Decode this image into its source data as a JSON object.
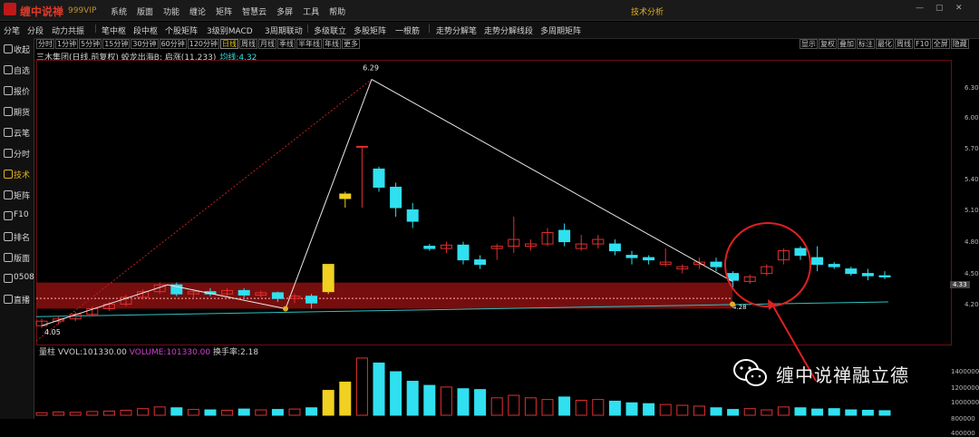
{
  "app": {
    "name": "缠中说禅",
    "version": "999VIP",
    "center_title": "技术分析"
  },
  "menu": [
    "系统",
    "版面",
    "功能",
    "缠论",
    "矩阵",
    "智慧云",
    "多屏",
    "工具",
    "帮助"
  ],
  "toolbar": [
    "分笔",
    "分段",
    "动力共振",
    "笔中枢",
    "段中枢",
    "个股矩阵",
    "3级别MACD",
    "3周期联动",
    "多级联立",
    "多股矩阵",
    "一根筋",
    "走势分解笔",
    "走势分解线段",
    "多周期矩阵"
  ],
  "sidebar": [
    {
      "label": "收起",
      "icon": "chevron-left-icon"
    },
    {
      "label": "自选",
      "icon": "star-icon"
    },
    {
      "label": "报价",
      "icon": "quote-icon"
    },
    {
      "label": "期货",
      "icon": "futures-icon"
    },
    {
      "label": "云笔",
      "icon": "cloud-icon"
    },
    {
      "label": "分时",
      "icon": "clock-icon"
    },
    {
      "label": "技术",
      "icon": "candlestick-icon",
      "active": true
    },
    {
      "label": "矩阵",
      "icon": "matrix-icon"
    },
    {
      "label": "F10",
      "icon": "f10-icon"
    },
    {
      "label": "排名",
      "icon": "ranking-icon"
    },
    {
      "label": "版面",
      "icon": "layout-icon"
    },
    {
      "label": "0508",
      "icon": "code-icon"
    },
    {
      "label": "直播",
      "icon": "live-icon"
    }
  ],
  "periods": [
    "分时",
    "1分钟",
    "5分钟",
    "15分钟",
    "30分钟",
    "60分钟",
    "120分钟",
    "日线",
    "周线",
    "月线",
    "季线",
    "半年线",
    "年线",
    "更多"
  ],
  "active_period": "日线",
  "right_buttons": [
    "显示",
    "复权",
    "叠加",
    "标注",
    "最化",
    "周线",
    "F10",
    "全屏",
    "隐藏"
  ],
  "info": {
    "text": "三木集团(日线,前复权) 蛟龙出海B: 启涨(11,233)",
    "ma": "均线:4.32"
  },
  "price_axis": [
    "6.30",
    "6.00",
    "5.70",
    "5.40",
    "5.10",
    "4.80",
    "4.50",
    "4.20"
  ],
  "current_price": "4.33",
  "volume_axis": [
    "1400000",
    "1200000",
    "1000000",
    "800000",
    "400000"
  ],
  "volume_header": {
    "label": "量柱",
    "vvol": "VVOL:101330.00",
    "volume": "VOLUME:101330.00",
    "turnover": "换手率:2.18"
  },
  "annotations": {
    "high": "6.29",
    "low": "4.05",
    "mark1": "4.28"
  },
  "watermark": "缠中说禅融立德",
  "colors": {
    "up": "#e03030",
    "down": "#30e0f0",
    "zone": "#8b1010",
    "accent": "#e0b020"
  },
  "chart_data": {
    "type": "candlestick",
    "ylim": [
      4.05,
      6.35
    ],
    "candles": [
      [
        4.12,
        4.16,
        4.1,
        4.18
      ],
      [
        4.16,
        4.18,
        4.13,
        4.2
      ],
      [
        4.18,
        4.22,
        4.16,
        4.24
      ],
      [
        4.22,
        4.27,
        4.2,
        4.29
      ],
      [
        4.27,
        4.31,
        4.25,
        4.33
      ],
      [
        4.31,
        4.37,
        4.29,
        4.39
      ],
      [
        4.37,
        4.42,
        4.35,
        4.44
      ],
      [
        4.42,
        4.48,
        4.4,
        4.5
      ],
      [
        4.48,
        4.4,
        4.38,
        4.5
      ],
      [
        4.4,
        4.42,
        4.37,
        4.44
      ],
      [
        4.42,
        4.4,
        4.38,
        4.45
      ],
      [
        4.4,
        4.43,
        4.38,
        4.45
      ],
      [
        4.43,
        4.39,
        4.37,
        4.45
      ],
      [
        4.39,
        4.41,
        4.37,
        4.43
      ],
      [
        4.41,
        4.36,
        4.33,
        4.42
      ],
      [
        4.36,
        4.38,
        4.32,
        4.4
      ],
      [
        4.38,
        4.32,
        4.27,
        4.4
      ],
      [
        4.66,
        4.42,
        4.4,
        4.66
      ],
      [
        5.28,
        5.24,
        5.16,
        5.3
      ],
      [
        5.7,
        5.7,
        5.16,
        5.7
      ],
      [
        5.5,
        5.34,
        5.3,
        5.52
      ],
      [
        5.34,
        5.16,
        5.08,
        5.38
      ],
      [
        5.14,
        5.04,
        4.98,
        5.2
      ],
      [
        4.82,
        4.8,
        4.78,
        4.84
      ],
      [
        4.8,
        4.83,
        4.76,
        4.86
      ],
      [
        4.83,
        4.7,
        4.66,
        4.86
      ],
      [
        4.7,
        4.66,
        4.62,
        4.74
      ],
      [
        4.8,
        4.82,
        4.7,
        4.84
      ],
      [
        4.82,
        4.88,
        4.76,
        5.08
      ],
      [
        4.82,
        4.84,
        4.78,
        4.88
      ],
      [
        4.84,
        4.94,
        4.82,
        4.98
      ],
      [
        4.96,
        4.86,
        4.82,
        5.02
      ],
      [
        4.8,
        4.84,
        4.78,
        4.92
      ],
      [
        4.84,
        4.88,
        4.8,
        4.92
      ],
      [
        4.84,
        4.78,
        4.74,
        4.88
      ],
      [
        4.74,
        4.72,
        4.66,
        4.78
      ],
      [
        4.72,
        4.7,
        4.66,
        4.74
      ],
      [
        4.66,
        4.68,
        4.64,
        4.8
      ],
      [
        4.62,
        4.64,
        4.58,
        4.66
      ],
      [
        4.66,
        4.68,
        4.62,
        4.72
      ],
      [
        4.68,
        4.64,
        4.6,
        4.72
      ],
      [
        4.58,
        4.52,
        4.46,
        4.6
      ],
      [
        4.51,
        4.55,
        4.49,
        4.57
      ],
      [
        4.58,
        4.64,
        4.56,
        4.66
      ],
      [
        4.7,
        4.78,
        4.66,
        4.8
      ],
      [
        4.8,
        4.74,
        4.7,
        4.82
      ],
      [
        4.72,
        4.66,
        4.6,
        4.82
      ],
      [
        4.66,
        4.64,
        4.62,
        4.68
      ],
      [
        4.62,
        4.58,
        4.56,
        4.64
      ],
      [
        4.58,
        4.56,
        4.52,
        4.62
      ],
      [
        4.56,
        4.55,
        4.53,
        4.6
      ]
    ],
    "volumes": [
      60,
      80,
      70,
      90,
      100,
      120,
      160,
      200,
      180,
      140,
      130,
      120,
      150,
      130,
      140,
      150,
      180,
      600,
      800,
      1380,
      1260,
      1050,
      820,
      720,
      680,
      640,
      620,
      420,
      480,
      420,
      380,
      440,
      360,
      380,
      340,
      300,
      280,
      260,
      240,
      220,
      180,
      140,
      160,
      130,
      200,
      180,
      150,
      160,
      130,
      120,
      110
    ]
  }
}
